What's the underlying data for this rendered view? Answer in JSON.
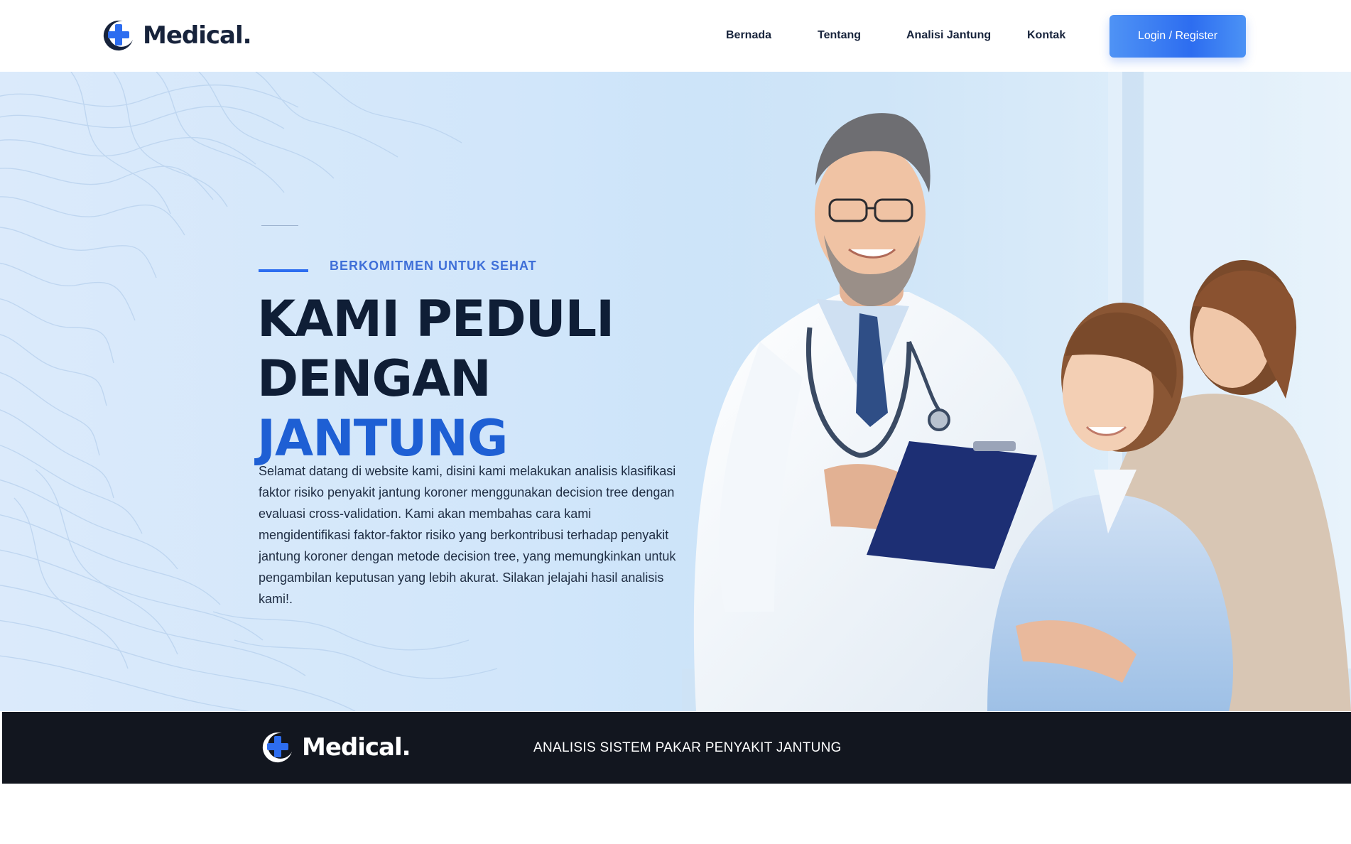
{
  "brand": {
    "name": "Medical.",
    "accent_color": "#2d6df0",
    "dark_color": "#0f1e36"
  },
  "nav": {
    "items": [
      {
        "label": "Bernada"
      },
      {
        "label": "Tentang"
      },
      {
        "label": "Analisi Jantung"
      },
      {
        "label": "Kontak"
      }
    ],
    "login_label": "Login / Register"
  },
  "hero": {
    "eyebrow": "BERKOMITMEN UNTUK SEHAT",
    "headline_line1": "KAMI PEDULI",
    "headline_line2": "DENGAN",
    "headline_accent": "JANTUNG",
    "intro": "Selamat datang di website kami, disini kami melakukan analisis klasifikasi faktor risiko penyakit jantung koroner menggunakan decision tree dengan evaluasi cross-validation. Kami akan membahas cara kami mengidentifikasi faktor-faktor risiko yang berkontribusi terhadap penyakit jantung koroner dengan metode decision tree, yang memungkinkan untuk pengambilan keputusan yang lebih akurat. Silakan jelajahi hasil analisis kami!."
  },
  "footer_band": {
    "title": "ANALISIS SISTEM PAKAR PENYAKIT JANTUNG"
  },
  "icons": [
    "medical-cross-logo-icon"
  ]
}
